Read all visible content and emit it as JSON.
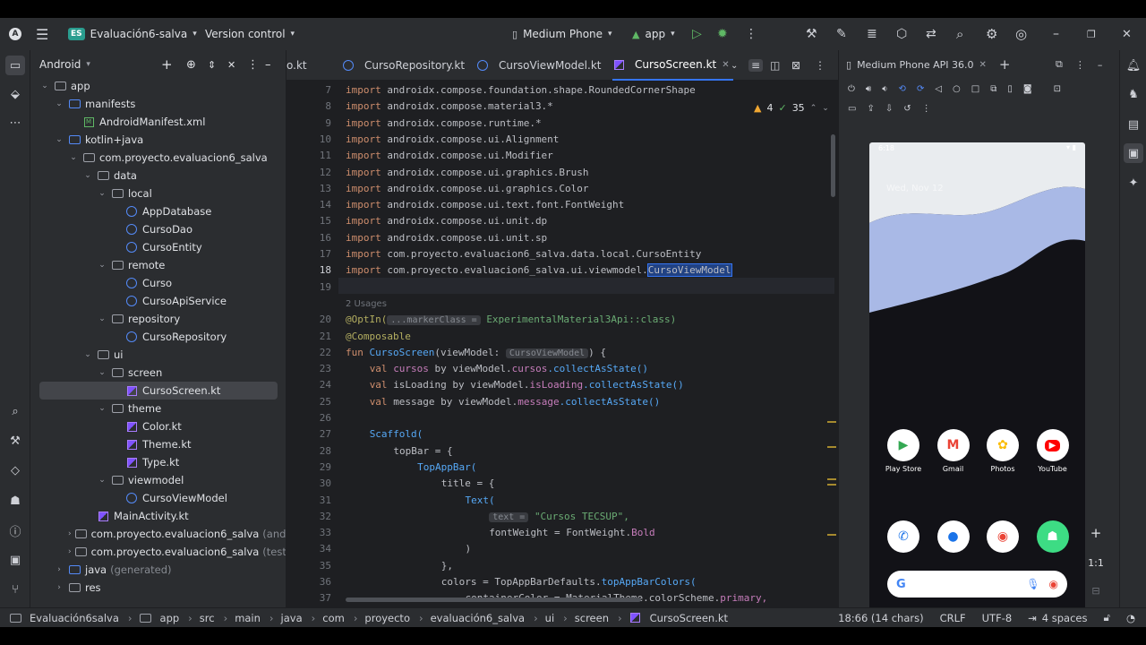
{
  "titlebar": {
    "app_icon": "android-studio-icon",
    "project_badge": "ES",
    "project_name": "Evaluación6-salva",
    "version_control": "Version control",
    "device": "Medium Phone",
    "run_config": "app"
  },
  "project_panel": {
    "title": "Android",
    "tree": [
      {
        "label": "app",
        "depth": 0,
        "kind": "module",
        "open": true
      },
      {
        "label": "manifests",
        "depth": 1,
        "kind": "folder-blue",
        "open": true
      },
      {
        "label": "AndroidManifest.xml",
        "depth": 2,
        "kind": "xml"
      },
      {
        "label": "kotlin+java",
        "depth": 1,
        "kind": "folder-blue",
        "open": true
      },
      {
        "label": "com.proyecto.evaluacion6_salva",
        "depth": 2,
        "kind": "folder",
        "open": true
      },
      {
        "label": "data",
        "depth": 3,
        "kind": "folder",
        "open": true
      },
      {
        "label": "local",
        "depth": 4,
        "kind": "folder",
        "open": true
      },
      {
        "label": "AppDatabase",
        "depth": 5,
        "kind": "class"
      },
      {
        "label": "CursoDao",
        "depth": 5,
        "kind": "class"
      },
      {
        "label": "CursoEntity",
        "depth": 5,
        "kind": "class"
      },
      {
        "label": "remote",
        "depth": 4,
        "kind": "folder",
        "open": true
      },
      {
        "label": "Curso",
        "depth": 5,
        "kind": "class"
      },
      {
        "label": "CursoApiService",
        "depth": 5,
        "kind": "class"
      },
      {
        "label": "repository",
        "depth": 4,
        "kind": "folder",
        "open": true
      },
      {
        "label": "CursoRepository",
        "depth": 5,
        "kind": "class"
      },
      {
        "label": "ui",
        "depth": 3,
        "kind": "folder",
        "open": true
      },
      {
        "label": "screen",
        "depth": 4,
        "kind": "folder",
        "open": true
      },
      {
        "label": "CursoScreen.kt",
        "depth": 5,
        "kind": "kt",
        "selected": true
      },
      {
        "label": "theme",
        "depth": 4,
        "kind": "folder",
        "open": true
      },
      {
        "label": "Color.kt",
        "depth": 5,
        "kind": "kt"
      },
      {
        "label": "Theme.kt",
        "depth": 5,
        "kind": "kt"
      },
      {
        "label": "Type.kt",
        "depth": 5,
        "kind": "kt"
      },
      {
        "label": "viewmodel",
        "depth": 4,
        "kind": "folder",
        "open": true
      },
      {
        "label": "CursoViewModel",
        "depth": 5,
        "kind": "class"
      },
      {
        "label": "MainActivity.kt",
        "depth": 3,
        "kind": "kt"
      },
      {
        "label": "com.proyecto.evaluacion6_salva",
        "suffix": "(androidTest)",
        "depth": 2,
        "kind": "folder",
        "open": false
      },
      {
        "label": "com.proyecto.evaluacion6_salva",
        "suffix": "(test)",
        "depth": 2,
        "kind": "folder",
        "open": false
      },
      {
        "label": "java",
        "suffix": "(generated)",
        "depth": 1,
        "kind": "folder-blue",
        "open": false
      },
      {
        "label": "res",
        "depth": 1,
        "kind": "folder",
        "open": false
      }
    ]
  },
  "editor": {
    "tabs": [
      {
        "label": "o.kt",
        "kind": "kt"
      },
      {
        "label": "CursoRepository.kt",
        "kind": "class"
      },
      {
        "label": "CursoViewModel.kt",
        "kind": "class"
      },
      {
        "label": "CursoScreen.kt",
        "kind": "kt",
        "active": true
      }
    ],
    "warnings": "4",
    "checks": "35",
    "line_numbers": [
      "7",
      "8",
      "9",
      "10",
      "11",
      "12",
      "13",
      "14",
      "15",
      "16",
      "17",
      "18",
      "19",
      "",
      "20",
      "21",
      "22",
      "23",
      "24",
      "25",
      "26",
      "27",
      "28",
      "29",
      "30",
      "31",
      "32",
      "33",
      "34",
      "35",
      "36",
      "37"
    ],
    "current_line": "18",
    "usages": "2 Usages",
    "imports": [
      "androidx.compose.foundation.shape.RoundedCornerShape",
      "androidx.compose.material3.*",
      "androidx.compose.runtime.*",
      "androidx.compose.ui.Alignment",
      "androidx.compose.ui.Modifier",
      "androidx.compose.ui.graphics.Brush",
      "androidx.compose.ui.graphics.Color",
      "androidx.compose.ui.text.font.FontWeight",
      "androidx.compose.ui.unit.dp",
      "androidx.compose.ui.unit.sp",
      "com.proyecto.evaluacion6_salva.data.local.CursoEntity",
      "com.proyecto.evaluacion6_salva.ui.viewmodel."
    ],
    "selected_word": "CursoViewModel",
    "kw_import": "import",
    "optin": "@OptIn(",
    "optin_hint": "...markerClass =",
    "optin_arg": "ExperimentalMaterial3Api::class)",
    "composable": "@Composable",
    "fun_kw": "fun",
    "fun_name": "CursoScreen",
    "fun_params": "(viewModel: ",
    "fun_type": "CursoViewModel",
    "fun_end": ") {",
    "val_kw": "val",
    "v1_name": "cursos",
    "v1_rest": " by viewModel.",
    "v1_prop": "cursos",
    "v1_call": ".collectAsState()",
    "v2_name": "isLoading",
    "v2_rest": " by viewModel.",
    "v2_prop": "isLoading",
    "v2_call": ".collectAsState()",
    "v3_name": "message",
    "v3_rest": " by viewModel.",
    "v3_prop": "message",
    "v3_call": ".collectAsState()",
    "scaffold": "Scaffold(",
    "topbar": "topBar = {",
    "topappbar": "TopAppBar(",
    "title_line": "title = {",
    "text_call": "Text(",
    "text_hint": "text =",
    "text_str": "\"Cursos TECSUP\",",
    "fontweight": "fontWeight = FontWeight.",
    "bold": "Bold",
    "close_paren": ")",
    "close_brace": "},",
    "colors_line": "colors = TopAppBarDefaults.",
    "colors_fn": "topAppBarColors(",
    "container_line": "containerColor = MaterialTheme.colorScheme.",
    "primary": "primary,"
  },
  "emulator": {
    "tab_title": "Medium Phone API 36.0",
    "time": "6:18",
    "date": "Wed, Nov 12",
    "zoom": "1:1",
    "apps_row1": [
      {
        "label": "Play Store",
        "glyph": "▶",
        "color": "#34a853"
      },
      {
        "label": "Gmail",
        "glyph": "M",
        "color": "#ea4335"
      },
      {
        "label": "Photos",
        "glyph": "✿",
        "color": "#fbbc04"
      },
      {
        "label": "YouTube",
        "glyph": "▶",
        "color": "#ffffff"
      }
    ],
    "apps_row2": [
      {
        "glyph": "✆",
        "color": "#1a73e8"
      },
      {
        "glyph": "●",
        "color": "#1a73e8"
      },
      {
        "glyph": "◉",
        "color": "#ea4335"
      },
      {
        "glyph": "☗",
        "color": "#ffffff"
      }
    ],
    "search_g": "G"
  },
  "statusbar": {
    "crumbs": [
      "Evaluación6salva",
      "app",
      "src",
      "main",
      "java",
      "com",
      "proyecto",
      "evaluación6_salva",
      "ui",
      "screen",
      "CursoScreen.kt"
    ],
    "position": "18:66 (14 chars)",
    "line_ending": "CRLF",
    "encoding": "UTF-8",
    "indent": "4 spaces"
  }
}
